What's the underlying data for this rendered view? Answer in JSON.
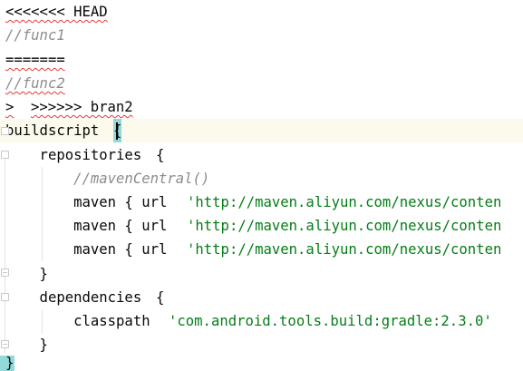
{
  "editor": {
    "lines": {
      "l1": "<<<<<<< HEAD",
      "l2": "//func1",
      "l3": "=======",
      "l4": "//func2",
      "l5a": ">",
      "l5b": ">>>>>> bran2",
      "l6a": "buildscript ",
      "l6b": "{",
      "l7a": "    repositories ",
      "l7b": "{",
      "l8": "        //mavenCentral()",
      "maven_prefix": "        maven { url ",
      "maven_url": "'http://maven.aliyun.com/nexus/conten",
      "l12": "    }",
      "l13a": "    dependencies ",
      "l13b": "{",
      "l14a": "        classpath ",
      "l14b": "'com.android.tools.build:gradle:2.3.0'",
      "l15": "    }",
      "l16": "}"
    },
    "icons": {
      "bulb": "lightbulb-icon",
      "fold": "fold-marker-icon"
    },
    "colors": {
      "string": "#067d17",
      "comment": "#8c8c8c",
      "brace_highlight": "#93d9d9",
      "error_underline": "#e53935",
      "current_line": "#fcfaed"
    }
  }
}
